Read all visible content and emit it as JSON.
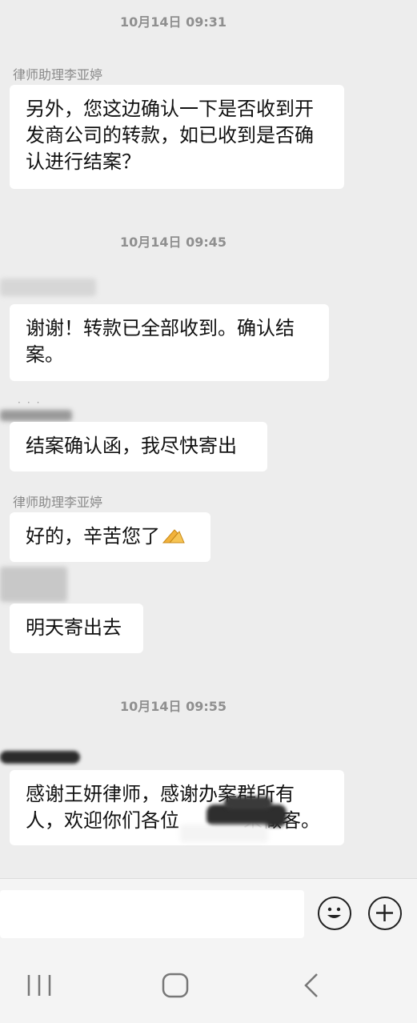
{
  "messages": {
    "ts1": "10月14日 09:31",
    "sender1": "律师助理李亚婷",
    "msg1_line1": "另外，您这边确认一下是否收到开",
    "msg1_line2": "发商公司的转款，如已收到是否确",
    "msg1_line3": "认进行结案？",
    "ts2": "10月14日 09:45",
    "msg2_line1": "谢谢！转款已全部收到。确认结",
    "msg2_line2": "案。",
    "msg3": "结案确认函，我尽快寄出",
    "sender2": "律师助理李亚婷",
    "msg4": "好的，辛苦您了",
    "msg5": "明天寄出去",
    "ts3": "10月14日 09:55",
    "msg6_line1": "感谢王妍律师，感谢办案群所有",
    "msg6_line2_a": "人，欢迎你们各位",
    "msg6_line2_b": "来做客。"
  },
  "icons": {
    "emoji": "emoji-icon",
    "plus": "plus-icon",
    "nav_recent": "recent-apps-icon",
    "nav_home": "home-icon",
    "nav_back": "back-icon"
  },
  "colors": {
    "background": "#ededed",
    "bubble": "#ffffff",
    "timestamp": "#8f8f8f"
  }
}
